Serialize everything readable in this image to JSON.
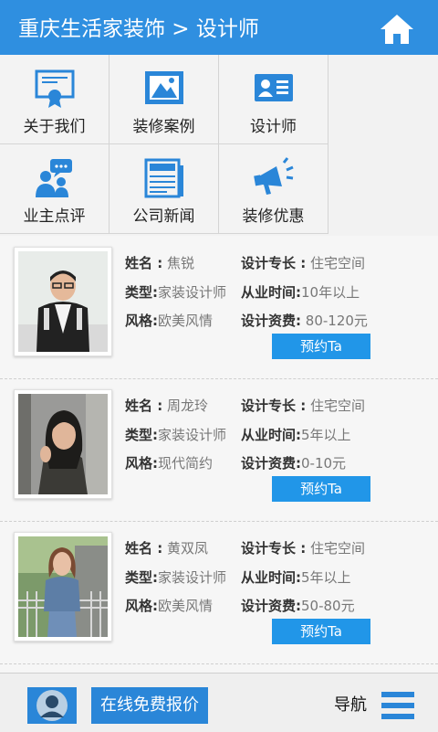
{
  "header": {
    "title": "重庆生活家装饰 > 设计师",
    "home_icon": "home-icon"
  },
  "nav_grid": [
    {
      "label": "关于我们",
      "icon": "certificate-icon"
    },
    {
      "label": "装修案例",
      "icon": "image-icon"
    },
    {
      "label": "设计师",
      "icon": "id-card-icon"
    },
    {
      "label": "业主点评",
      "icon": "users-chat-icon"
    },
    {
      "label": "公司新闻",
      "icon": "newspaper-icon"
    },
    {
      "label": "装修优惠",
      "icon": "megaphone-icon"
    }
  ],
  "designers": [
    {
      "name_label": "姓名 :",
      "name": "焦锐",
      "type_label": "类型:",
      "type": "家装设计师",
      "style_label": "风格:",
      "style": "欧美风情",
      "specialty_label": "设计专长 :",
      "specialty": "住宅空间",
      "experience_label": "从业时间:",
      "experience": "10年以上",
      "fee_label": "设计资费:",
      "fee": "80-120元",
      "book": "预约Ta"
    },
    {
      "name_label": "姓名 :",
      "name": "周龙玲",
      "type_label": "类型:",
      "type": "家装设计师",
      "style_label": "风格:",
      "style": "现代简约",
      "specialty_label": "设计专长 :",
      "specialty": "住宅空间",
      "experience_label": "从业时间:",
      "experience": "5年以上",
      "fee_label": "设计资费:",
      "fee": "0-10元",
      "book": "预约Ta"
    },
    {
      "name_label": "姓名 :",
      "name": "黄双凤",
      "type_label": "类型:",
      "type": "家装设计师",
      "style_label": "风格:",
      "style": "欧美风情",
      "specialty_label": "设计专长 :",
      "specialty": "住宅空间",
      "experience_label": "从业时间:",
      "experience": "5年以上",
      "fee_label": "设计资费:",
      "fee": "50-80元",
      "book": "预约Ta"
    }
  ],
  "bottom_bar": {
    "quote": "在线免费报价",
    "nav": "导航",
    "menu_icon": "hamburger-icon",
    "avatar_icon": "user-avatar-icon"
  },
  "colors": {
    "brand_blue": "#2f8fe0",
    "button_blue": "#2196e8"
  }
}
